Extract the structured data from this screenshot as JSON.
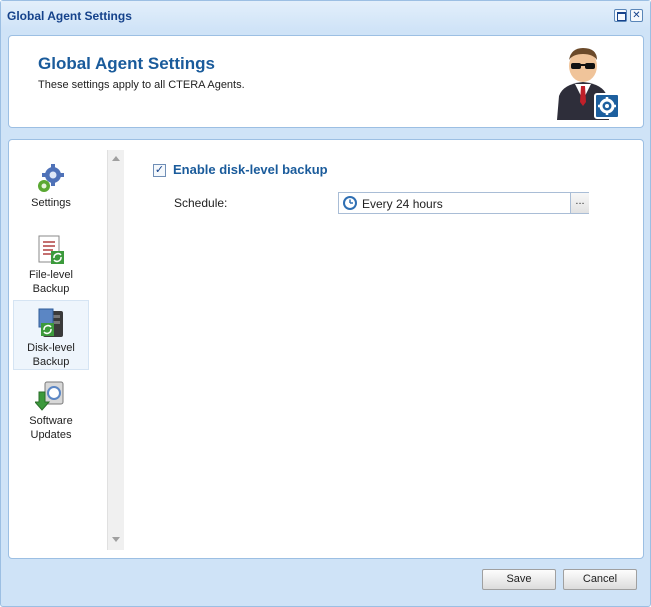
{
  "window": {
    "title": "Global Agent Settings",
    "maximize_icon": "maximize-icon",
    "close_icon": "close-icon",
    "close_glyph": "✕"
  },
  "header": {
    "title": "Global Agent Settings",
    "subtitle": "These settings apply to all CTERA Agents.",
    "avatar_icon": "agent-avatar-icon"
  },
  "nav": {
    "items": [
      {
        "label": "Settings",
        "icon": "gears-icon"
      },
      {
        "label": "File-level Backup",
        "icon": "file-backup-icon"
      },
      {
        "label": "Disk-level Backup",
        "icon": "disk-backup-icon",
        "selected": true
      },
      {
        "label": "Software Updates",
        "icon": "software-update-icon"
      }
    ]
  },
  "content": {
    "enable_checked": true,
    "check_glyph": "✓",
    "enable_label": "Enable disk-level backup",
    "schedule_label": "Schedule:",
    "schedule_value": "Every 24 hours",
    "schedule_icon": "clock-icon",
    "ellipsis_label": "..."
  },
  "footer": {
    "save_label": "Save",
    "cancel_label": "Cancel"
  },
  "colors": {
    "accent": "#1a5b9b",
    "window_bg": "#cfe3f7",
    "title_text": "#15428b"
  }
}
